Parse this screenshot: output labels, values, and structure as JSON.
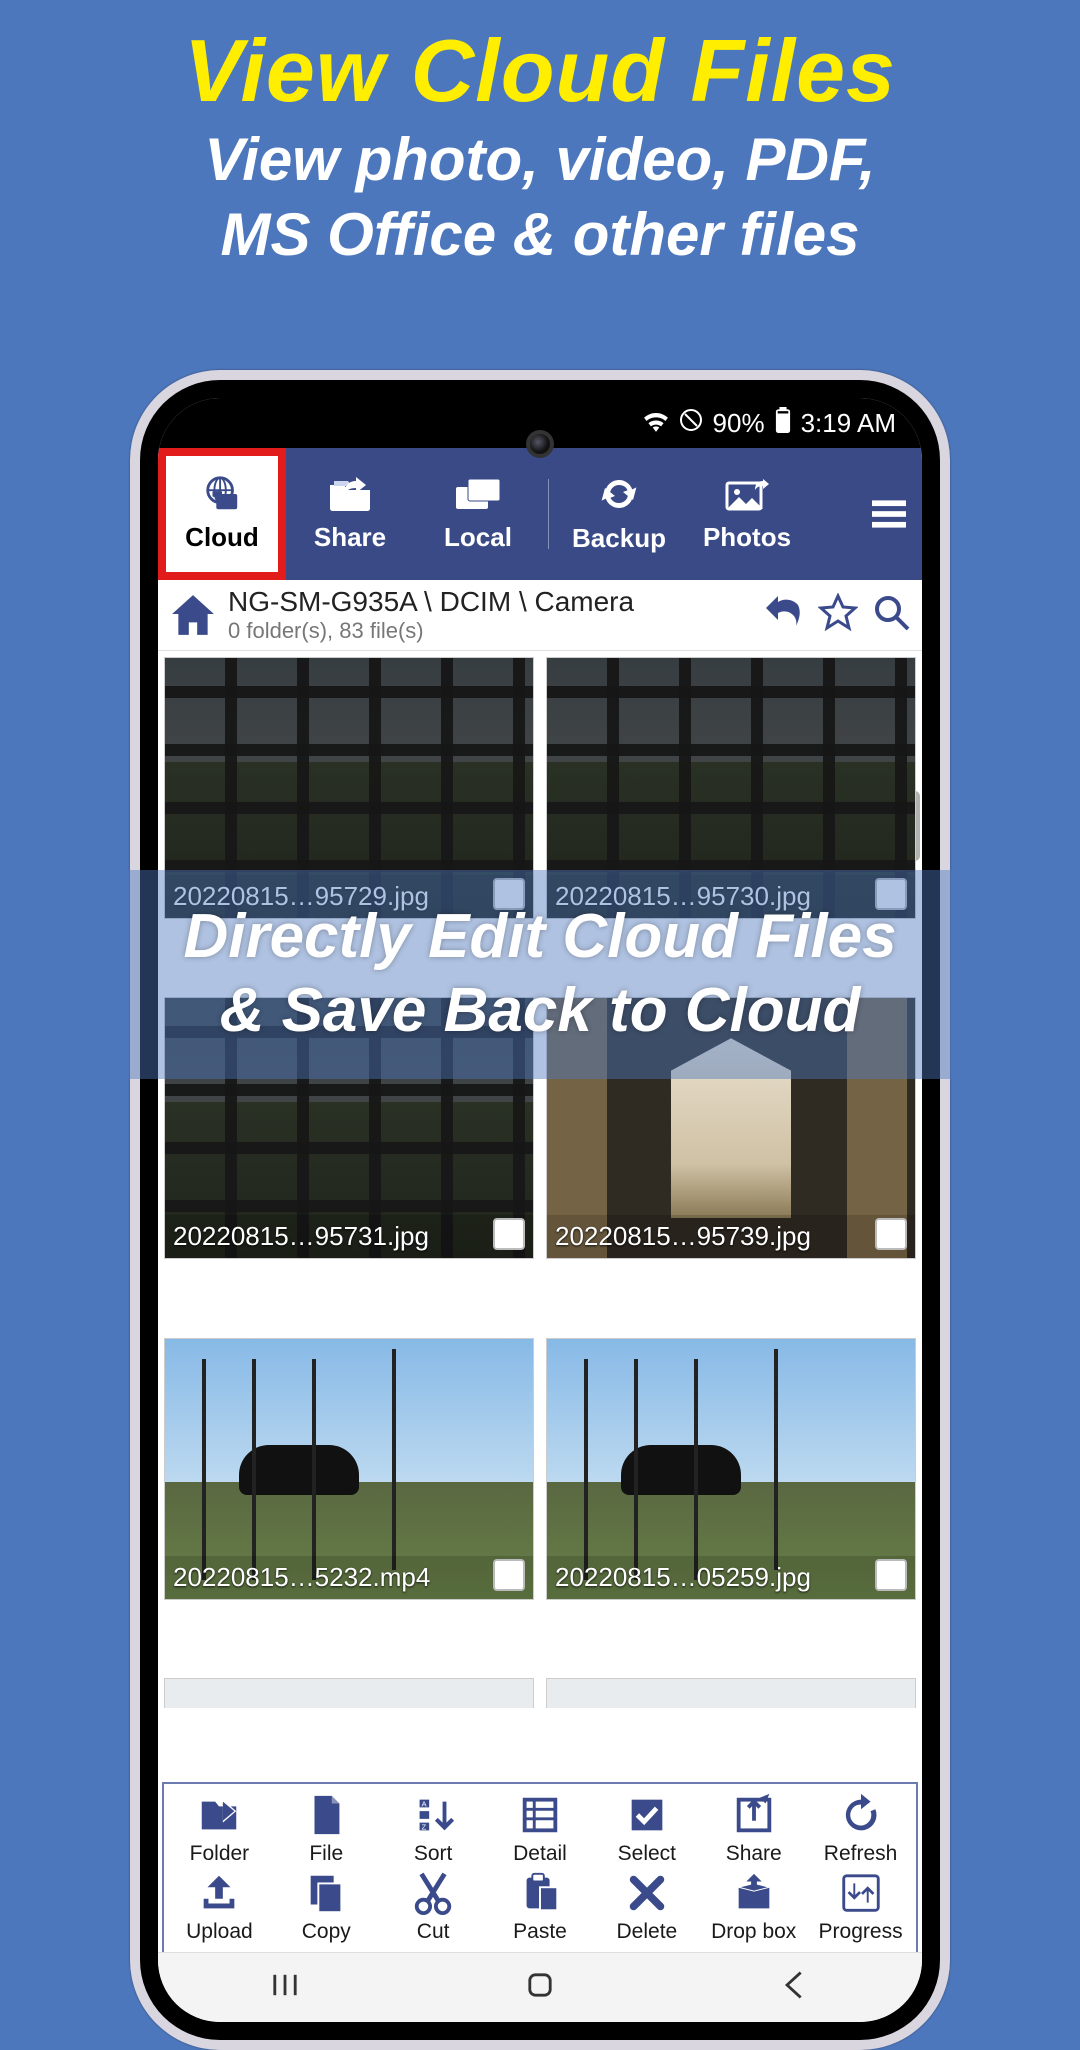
{
  "promo": {
    "title": "View Cloud Files",
    "subtitle_l1": "View photo, video, PDF,",
    "subtitle_l2": "MS Office & other files",
    "banner_l1": "Directly Edit Cloud Files",
    "banner_l2": "& Save Back to Cloud"
  },
  "status": {
    "battery": "90%",
    "time": "3:19 AM"
  },
  "tabs": {
    "cloud": "Cloud",
    "share": "Share",
    "local": "Local",
    "backup": "Backup",
    "photos": "Photos"
  },
  "path": {
    "breadcrumb": "NG-SM-G935A \\ DCIM \\ Camera",
    "summary": "0 folder(s), 83 file(s)"
  },
  "files": [
    {
      "name": "20220815…95729.jpg"
    },
    {
      "name": "20220815…95730.jpg"
    },
    {
      "name": "20220815…95731.jpg"
    },
    {
      "name": "20220815…95739.jpg"
    },
    {
      "name": "20220815…5232.mp4"
    },
    {
      "name": "20220815…05259.jpg"
    }
  ],
  "tools": {
    "folder": "Folder",
    "file": "File",
    "sort": "Sort",
    "detail": "Detail",
    "select": "Select",
    "share": "Share",
    "refresh": "Refresh",
    "upload": "Upload",
    "copy": "Copy",
    "cut": "Cut",
    "paste": "Paste",
    "delete": "Delete",
    "dropbox": "Drop box",
    "progress": "Progress"
  },
  "colors": {
    "bg": "#4d77bc",
    "accent": "#3a4a87",
    "highlight": "#e21b1b",
    "title": "#ffee00"
  }
}
